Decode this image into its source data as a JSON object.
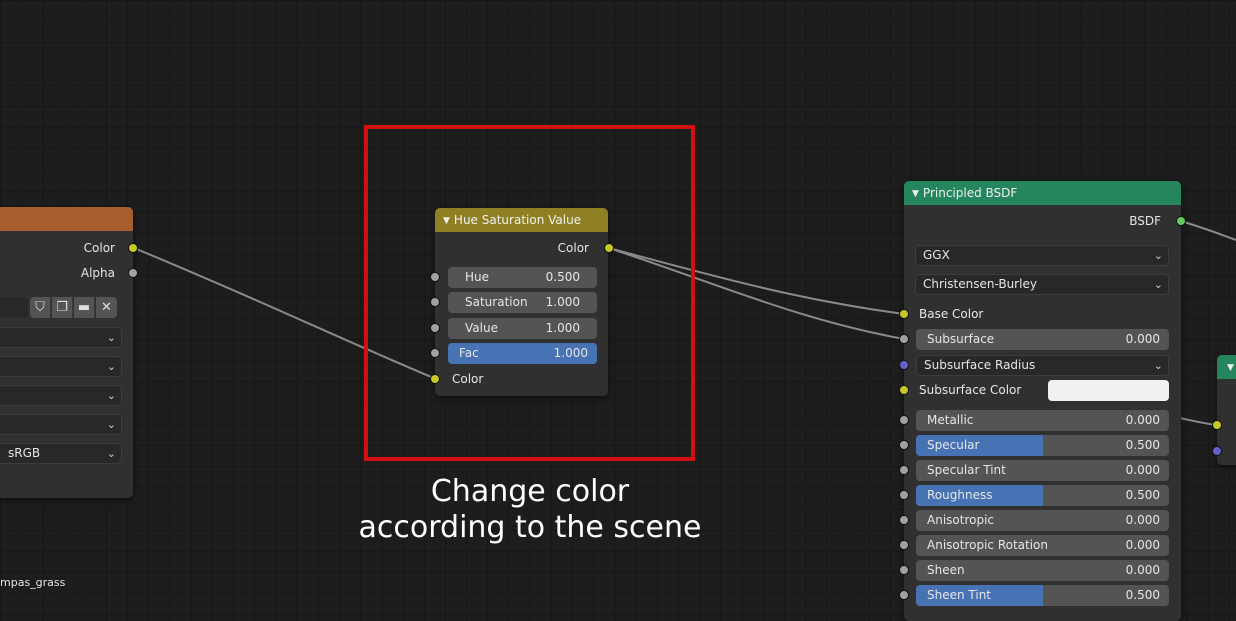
{
  "image_texture_node": {
    "outputs": [
      "Color",
      "Alpha"
    ],
    "image_name": "mpas_grass",
    "color_space": "sRGB",
    "header_color": "#a65e2d"
  },
  "hsv_node": {
    "title": "Hue Saturation Value",
    "header_color": "#8f8123",
    "output": "Color",
    "fields": [
      {
        "label": "Hue",
        "value": "0.500"
      },
      {
        "label": "Saturation",
        "value": "1.000"
      },
      {
        "label": "Value",
        "value": "1.000"
      },
      {
        "label": "Fac",
        "value": "1.000",
        "fill": 1.0
      }
    ],
    "input": "Color"
  },
  "bsdf_node": {
    "title": "Principled BSDF",
    "header_color": "#25855d",
    "output": "BSDF",
    "distribution": "GGX",
    "subsurface_method": "Christensen-Burley",
    "base_color_label": "Base Color",
    "subsurface": {
      "label": "Subsurface",
      "value": "0.000"
    },
    "subsurface_radius": "Subsurface Radius",
    "subsurface_color": {
      "label": "Subsurface Color",
      "swatch": "#f0f0f0"
    },
    "fields": [
      {
        "label": "Metallic",
        "value": "0.000",
        "fill": 0.0
      },
      {
        "label": "Specular",
        "value": "0.500",
        "fill": 0.5
      },
      {
        "label": "Specular Tint",
        "value": "0.000",
        "fill": 0.0
      },
      {
        "label": "Roughness",
        "value": "0.500",
        "fill": 0.5
      },
      {
        "label": "Anisotropic",
        "value": "0.000",
        "fill": 0.0
      },
      {
        "label": "Anisotropic Rotation",
        "value": "0.000",
        "fill": 0.0
      },
      {
        "label": "Sheen",
        "value": "0.000",
        "fill": 0.0
      },
      {
        "label": "Sheen Tint",
        "value": "0.500",
        "fill": 0.5
      }
    ]
  },
  "annotation": {
    "line1": "Change color",
    "line2": "according to the scene"
  },
  "colors": {
    "highlight": "#d40f0f",
    "slider_fill": "#4772b3",
    "wire": "#8a8a8a"
  }
}
